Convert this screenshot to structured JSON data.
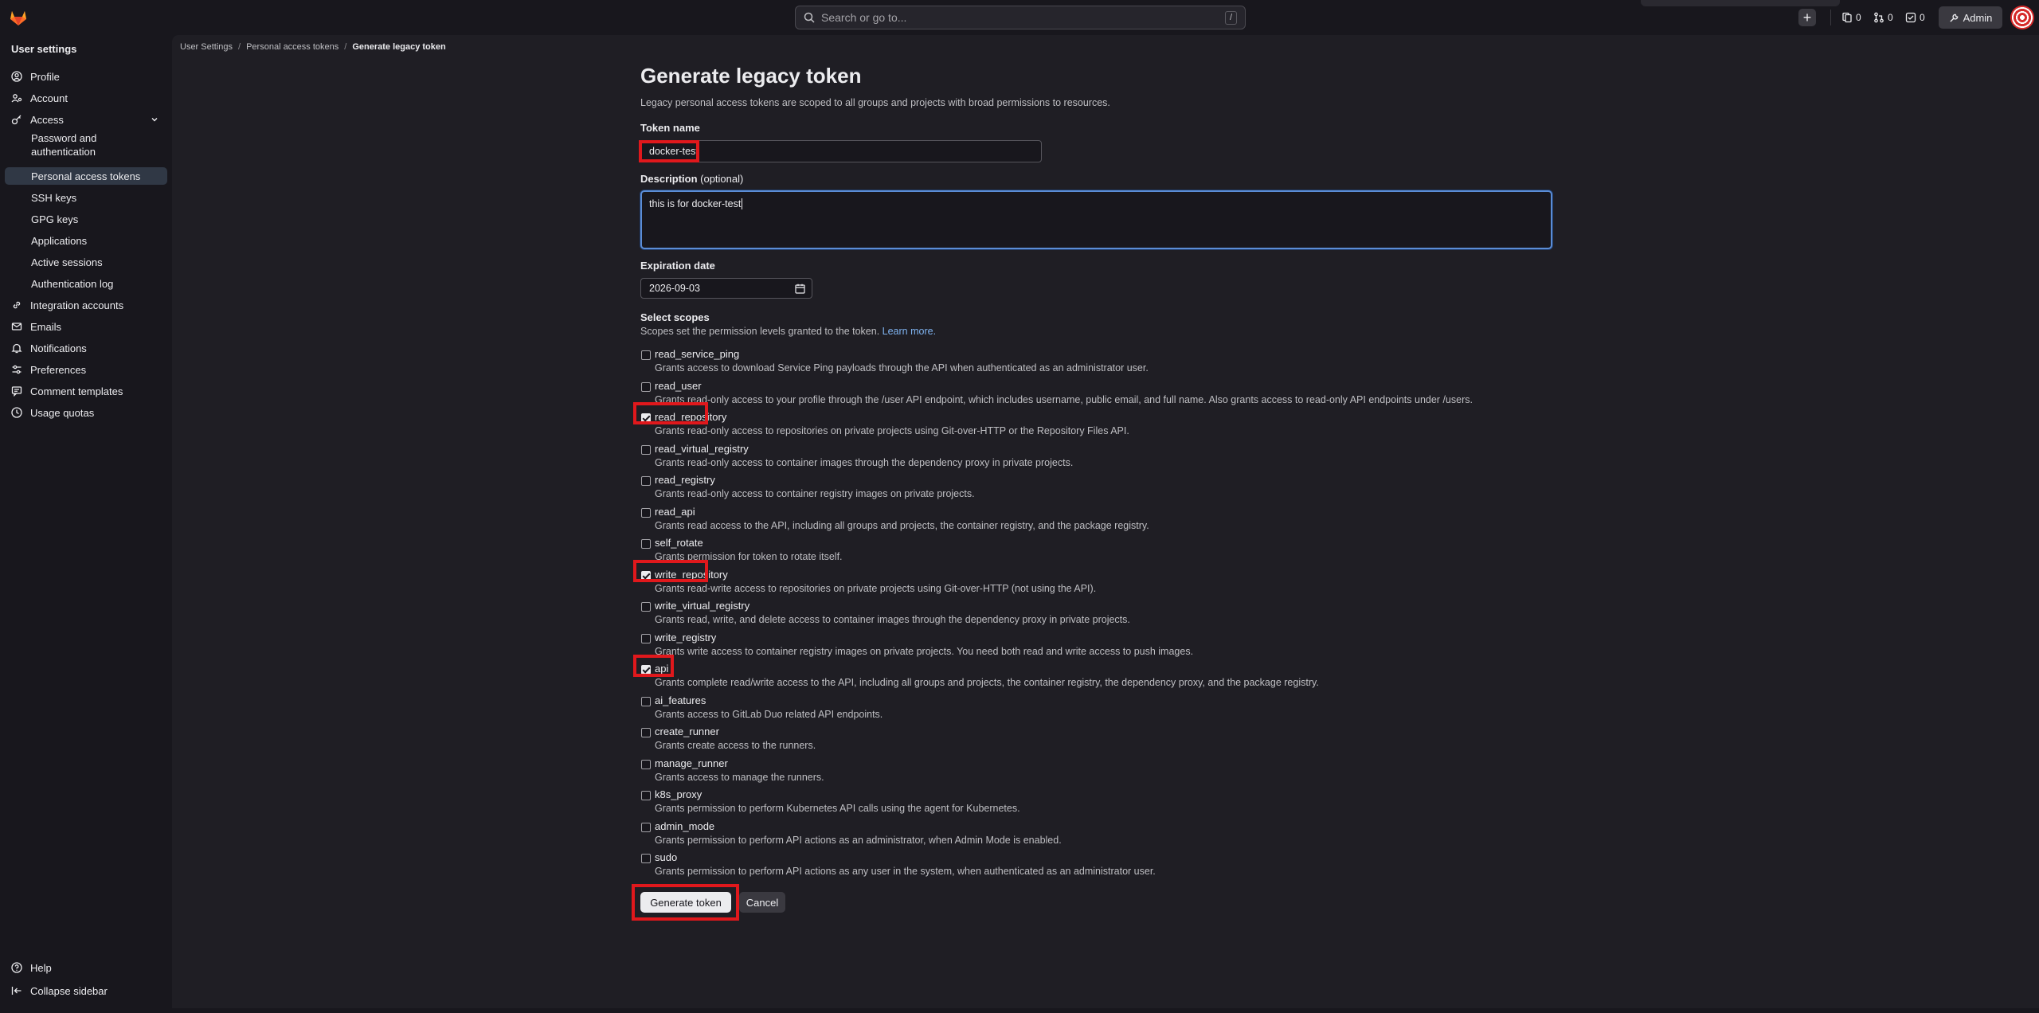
{
  "topbar": {
    "search_placeholder": "Search or go to...",
    "search_shortcut": "/",
    "plus_label": "+",
    "issues_count": "0",
    "merge_requests_count": "0",
    "todos_count": "0",
    "admin_label": "Admin"
  },
  "sidebar": {
    "title": "User settings",
    "items": [
      {
        "label": "Profile",
        "icon": "profile-icon"
      },
      {
        "label": "Account",
        "icon": "account-icon"
      },
      {
        "label": "Access",
        "icon": "key-icon"
      },
      {
        "label": "Password and authentication"
      },
      {
        "label": "Personal access tokens"
      },
      {
        "label": "SSH keys"
      },
      {
        "label": "GPG keys"
      },
      {
        "label": "Applications"
      },
      {
        "label": "Active sessions"
      },
      {
        "label": "Authentication log"
      },
      {
        "label": "Integration accounts",
        "icon": "link-icon"
      },
      {
        "label": "Emails",
        "icon": "mail-icon"
      },
      {
        "label": "Notifications",
        "icon": "bell-icon"
      },
      {
        "label": "Preferences",
        "icon": "preferences-icon"
      },
      {
        "label": "Comment templates",
        "icon": "comment-icon"
      },
      {
        "label": "Usage quotas",
        "icon": "quota-icon"
      }
    ],
    "help_label": "Help",
    "collapse_label": "Collapse sidebar"
  },
  "breadcrumb": [
    "User Settings",
    "Personal access tokens",
    "Generate legacy token"
  ],
  "page": {
    "title": "Generate legacy token",
    "lead": "Legacy personal access tokens are scoped to all groups and projects with broad permissions to resources.",
    "token_name_label": "Token name",
    "token_name_value": "docker-test",
    "description_label": "Description",
    "description_optional": "(optional)",
    "description_value": "this is for docker-test",
    "expiration_label": "Expiration date",
    "expiration_value": "2026-09-03",
    "scopes_label": "Select scopes",
    "scopes_help": "Scopes set the permission levels granted to the token.",
    "scopes_link": "Learn more.",
    "generate_button": "Generate token",
    "cancel_button": "Cancel"
  },
  "scopes": [
    {
      "name": "read_service_ping",
      "desc": "Grants access to download Service Ping payloads through the API when authenticated as an administrator user.",
      "checked": false
    },
    {
      "name": "read_user",
      "desc": "Grants read-only access to your profile through the /user API endpoint, which includes username, public email, and full name. Also grants access to read-only API endpoints under /users.",
      "checked": false
    },
    {
      "name": "read_repository",
      "desc": "Grants read-only access to repositories on private projects using Git-over-HTTP or the Repository Files API.",
      "checked": true
    },
    {
      "name": "read_virtual_registry",
      "desc": "Grants read-only access to container images through the dependency proxy in private projects.",
      "checked": false
    },
    {
      "name": "read_registry",
      "desc": "Grants read-only access to container registry images on private projects.",
      "checked": false
    },
    {
      "name": "read_api",
      "desc": "Grants read access to the API, including all groups and projects, the container registry, and the package registry.",
      "checked": false
    },
    {
      "name": "self_rotate",
      "desc": "Grants permission for token to rotate itself.",
      "checked": false
    },
    {
      "name": "write_repository",
      "desc": "Grants read-write access to repositories on private projects using Git-over-HTTP (not using the API).",
      "checked": true
    },
    {
      "name": "write_virtual_registry",
      "desc": "Grants read, write, and delete access to container images through the dependency proxy in private projects.",
      "checked": false
    },
    {
      "name": "write_registry",
      "desc": "Grants write access to container registry images on private projects. You need both read and write access to push images.",
      "checked": false
    },
    {
      "name": "api",
      "desc": "Grants complete read/write access to the API, including all groups and projects, the container registry, the dependency proxy, and the package registry.",
      "checked": true
    },
    {
      "name": "ai_features",
      "desc": "Grants access to GitLab Duo related API endpoints.",
      "checked": false
    },
    {
      "name": "create_runner",
      "desc": "Grants create access to the runners.",
      "checked": false
    },
    {
      "name": "manage_runner",
      "desc": "Grants access to manage the runners.",
      "checked": false
    },
    {
      "name": "k8s_proxy",
      "desc": "Grants permission to perform Kubernetes API calls using the agent for Kubernetes.",
      "checked": false
    },
    {
      "name": "admin_mode",
      "desc": "Grants permission to perform API actions as an administrator, when Admin Mode is enabled.",
      "checked": false
    },
    {
      "name": "sudo",
      "desc": "Grants permission to perform API actions as any user in the system, when authenticated as an administrator user.",
      "checked": false
    }
  ],
  "colors": {
    "background": "#18171d",
    "panel": "#1f1e24",
    "highlight": "#e0181c",
    "accent_link": "#7fb3f0",
    "focus_border": "#5b8dd6"
  }
}
